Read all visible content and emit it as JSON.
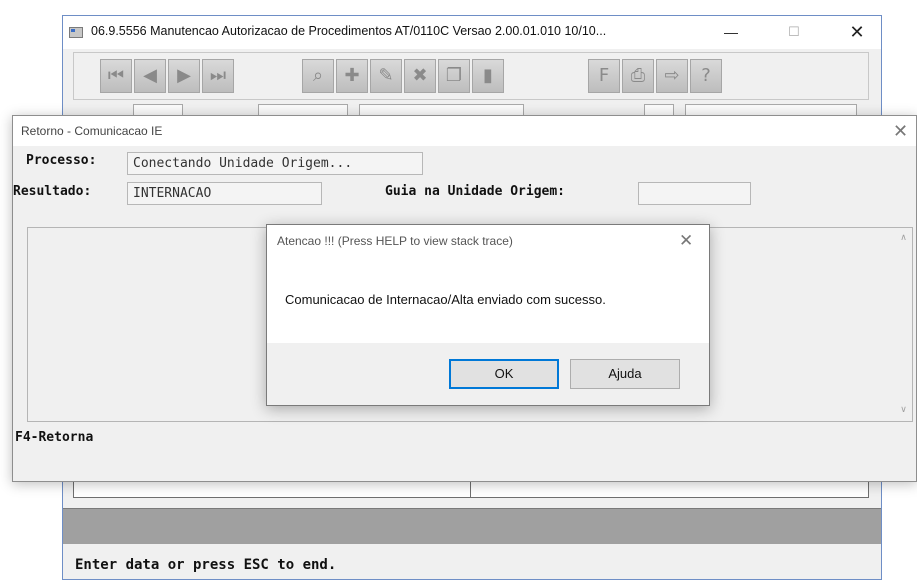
{
  "main_window": {
    "title": "06.9.5556 Manutencao Autorizacao de Procedimentos AT/0110C Versao 2.00.01.010 10/10...",
    "minimize_glyph": "—",
    "maximize_glyph": "☐",
    "close_glyph": "✕",
    "toolbar": [
      {
        "name": "first-record",
        "glyph": "⏮"
      },
      {
        "name": "previous-record",
        "glyph": "◀"
      },
      {
        "name": "next-record",
        "glyph": "▶"
      },
      {
        "name": "last-record",
        "glyph": "⏭"
      },
      {
        "name": "search",
        "glyph": "⌕"
      },
      {
        "name": "add",
        "glyph": "✚"
      },
      {
        "name": "modify",
        "glyph": "✎"
      },
      {
        "name": "delete",
        "glyph": "✖"
      },
      {
        "name": "copy",
        "glyph": "❐"
      },
      {
        "name": "open",
        "glyph": "▮"
      },
      {
        "name": "filter",
        "glyph": "F"
      },
      {
        "name": "print",
        "glyph": "⎙"
      },
      {
        "name": "exit",
        "glyph": "⇨"
      },
      {
        "name": "help",
        "glyph": "?"
      }
    ],
    "status_text": "Enter data or press ESC to end."
  },
  "retorno_dialog": {
    "title": "Retorno - Comunicacao IE",
    "close_glyph": "✕",
    "processo_label": "Processo:",
    "processo_value": "Conectando Unidade Origem...",
    "resultado_label": "Resultado:",
    "resultado_value": "INTERNACAO",
    "guia_label": "Guia na Unidade Origem:",
    "guia_value": "",
    "scroll_up_glyph": "∧",
    "scroll_down_glyph": "∨",
    "f4_label": "F4-Retorna"
  },
  "message_box": {
    "title": "Atencao !!!  (Press HELP to view stack trace)",
    "close_glyph": "✕",
    "message": "Comunicacao de Internacao/Alta enviado com sucesso.",
    "ok_label": "OK",
    "help_label": "Ajuda"
  }
}
